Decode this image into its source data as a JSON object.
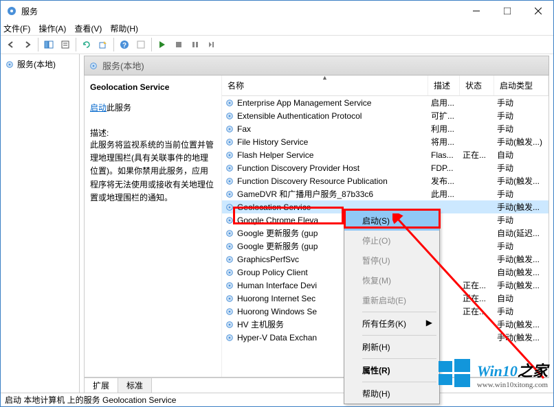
{
  "window": {
    "title": "服务"
  },
  "menubar": {
    "file": "文件(F)",
    "action": "操作(A)",
    "view": "查看(V)",
    "help": "帮助(H)"
  },
  "left_panel": {
    "item": "服务(本地)"
  },
  "right_header": {
    "title": "服务(本地)"
  },
  "detail": {
    "service_name": "Geolocation Service",
    "start_link": "启动",
    "start_suffix": "此服务",
    "desc_label": "描述:",
    "desc_text": "此服务将监视系统的当前位置并管理地理围栏(具有关联事件的地理位置)。如果你禁用此服务，应用程序将无法使用或接收有关地理位置或地理围栏的通知。"
  },
  "columns": {
    "name": "名称",
    "desc": "描述",
    "status": "状态",
    "startup": "启动类型"
  },
  "services": [
    {
      "name": "Enterprise App Management Service",
      "desc": "启用...",
      "status": "",
      "startup": "手动"
    },
    {
      "name": "Extensible Authentication Protocol",
      "desc": "可扩...",
      "status": "",
      "startup": "手动"
    },
    {
      "name": "Fax",
      "desc": "利用...",
      "status": "",
      "startup": "手动"
    },
    {
      "name": "File History Service",
      "desc": "将用...",
      "status": "",
      "startup": "手动(触发...)"
    },
    {
      "name": "Flash Helper Service",
      "desc": "Flas...",
      "status": "正在...",
      "startup": "自动"
    },
    {
      "name": "Function Discovery Provider Host",
      "desc": "FDP...",
      "status": "",
      "startup": "手动"
    },
    {
      "name": "Function Discovery Resource Publication",
      "desc": "发布...",
      "status": "",
      "startup": "手动(触发..."
    },
    {
      "name": "GameDVR 和广播用户服务_87b33c6",
      "desc": "此用...",
      "status": "",
      "startup": "手动"
    },
    {
      "name": "Geolocation Service",
      "desc": "...",
      "status": "",
      "startup": "手动(触发...",
      "selected": true
    },
    {
      "name": "Google Chrome Eleva",
      "desc": "",
      "status": "",
      "startup": "手动"
    },
    {
      "name": "Google 更新服务 (gup",
      "desc": "",
      "status": "",
      "startup": "自动(延迟..."
    },
    {
      "name": "Google 更新服务 (gup",
      "desc": "",
      "status": "",
      "startup": "手动"
    },
    {
      "name": "GraphicsPerfSvc",
      "desc": "",
      "status": "",
      "startup": "手动(触发..."
    },
    {
      "name": "Group Policy Client",
      "desc": "",
      "status": "",
      "startup": "自动(触发..."
    },
    {
      "name": "Human Interface Devi",
      "desc": "",
      "status": "正在...",
      "startup": "手动(触发..."
    },
    {
      "name": "Huorong Internet Sec",
      "desc": "",
      "status": "正在...",
      "startup": "自动"
    },
    {
      "name": "Huorong Windows Se",
      "desc": "",
      "status": "正在...",
      "startup": "手动"
    },
    {
      "name": "HV 主机服务",
      "desc": "",
      "status": "",
      "startup": "手动(触发..."
    },
    {
      "name": "Hyper-V Data Exchan",
      "desc": "",
      "status": "",
      "startup": "手动(触发..."
    }
  ],
  "context_menu": {
    "start": "启动(S)",
    "stop": "停止(O)",
    "pause": "暂停(U)",
    "resume": "恢复(M)",
    "restart": "重新启动(E)",
    "all_tasks": "所有任务(K)",
    "refresh": "刷新(H)",
    "properties": "属性(R)",
    "help": "帮助(H)"
  },
  "tabs": {
    "extended": "扩展",
    "standard": "标准"
  },
  "statusbar": {
    "text": "启动 本地计算机 上的服务 Geolocation Service"
  },
  "watermark": {
    "main1": "Win10",
    "main2": "之家",
    "url": "www.win10xitong.com"
  }
}
